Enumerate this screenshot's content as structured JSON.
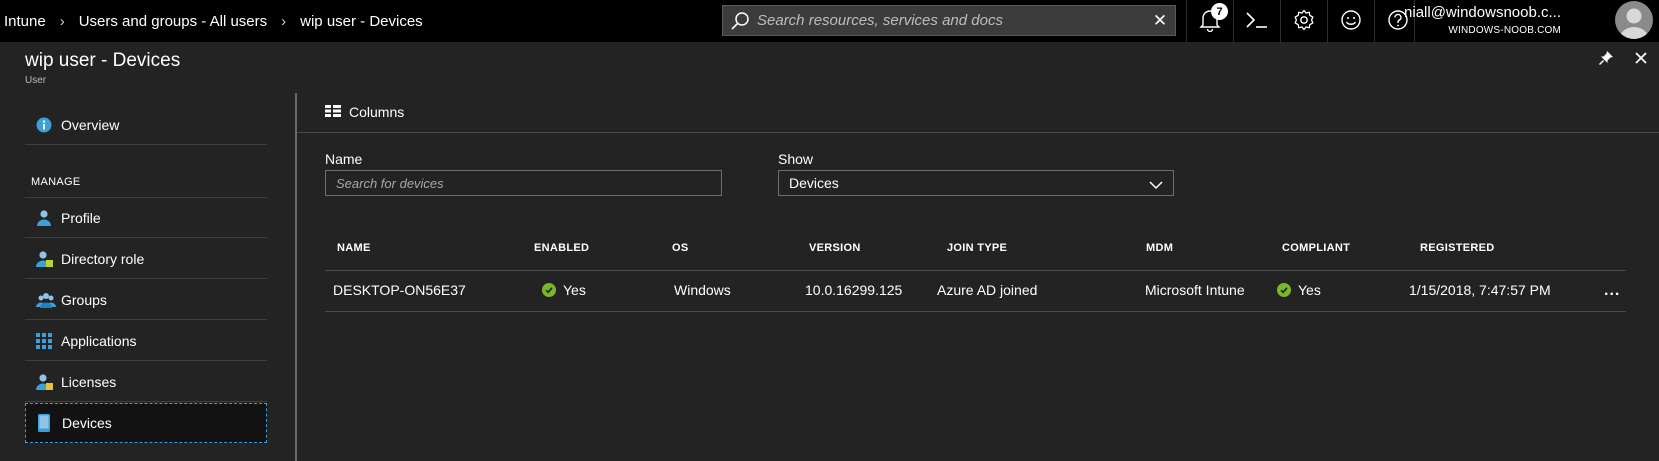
{
  "breadcrumb": [
    "Intune",
    "Users and groups - All users",
    "wip user - Devices"
  ],
  "search": {
    "placeholder": "Search resources, services and docs"
  },
  "notifications": {
    "count": "7"
  },
  "account": {
    "name": "niall@windowsnoob.c...",
    "directory": "WINDOWS-NOOB.COM"
  },
  "blade": {
    "title": "wip user - Devices",
    "subtitle": "User"
  },
  "menu": {
    "overview": "Overview",
    "manage_header": "MANAGE",
    "items": [
      "Profile",
      "Directory role",
      "Groups",
      "Applications",
      "Licenses",
      "Devices"
    ],
    "selected": "Devices"
  },
  "toolbar": {
    "columns_label": "Columns"
  },
  "filters": {
    "name_label": "Name",
    "name_placeholder": "Search for devices",
    "show_label": "Show",
    "show_value": "Devices"
  },
  "table": {
    "headers": [
      "NAME",
      "ENABLED",
      "OS",
      "VERSION",
      "JOIN TYPE",
      "MDM",
      "COMPLIANT",
      "REGISTERED"
    ],
    "rows": [
      {
        "name": "DESKTOP-ON56E37",
        "enabled": "Yes",
        "os": "Windows",
        "version": "10.0.16299.125",
        "join_type": "Azure AD joined",
        "mdm": "Microsoft Intune",
        "compliant": "Yes",
        "registered": "1/15/2018, 7:47:57 PM"
      }
    ],
    "row_menu_label": "..."
  },
  "colors": {
    "background": "#232323",
    "topbar": "#000000",
    "accent": "#3aa0d8",
    "status_ok": "#7ab729"
  },
  "icons": [
    "search-icon",
    "clear-icon",
    "bell-icon",
    "cloud-shell-icon",
    "gear-icon",
    "smiley-icon",
    "help-icon",
    "pin-icon",
    "close-icon",
    "info-icon",
    "user-icon",
    "directory-role-icon",
    "groups-icon",
    "applications-icon",
    "licenses-icon",
    "device-icon",
    "columns-icon",
    "chevron-down-icon",
    "check-icon"
  ]
}
